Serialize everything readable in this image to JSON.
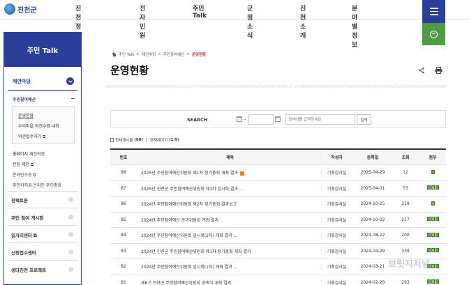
{
  "header": {
    "logo_text": "진천군",
    "nav": [
      "진천 정보공개",
      "전자민원",
      "주민 Talk",
      "군정소식",
      "진천소개",
      "분야별정보"
    ]
  },
  "sidebar": {
    "title": "주민 Talk",
    "category": "제안마당",
    "sub_items": [
      "주민참여예산",
      "운영현황",
      "우리마을 의견수렴 내용",
      "의견접수하기 ⧉"
    ],
    "other_items": [
      "홈페이지 개선의견",
      "전정 제안 ⧉",
      "온라인소송 ⧉",
      "주민자치회 온라인 주민총회"
    ],
    "main_items": [
      "정책토론",
      "주민 참여 게시판",
      "일자리센터 ⧉",
      "신청접수센터",
      "생다진천 프로젝트"
    ]
  },
  "breadcrumb": [
    "주민 Talk",
    "제안마당",
    "주민참여예산",
    "운영현황"
  ],
  "page": {
    "title": "운영현황"
  },
  "search": {
    "label": "SEARCH",
    "dash": "-",
    "keyword_placeholder": "검색어를 입력하세요",
    "submit_label": "검색"
  },
  "count": {
    "total_label": "전체게시물",
    "total": "(88)",
    "page_label": "현재페이지",
    "page": "(1/9)"
  },
  "board": {
    "headers": [
      "번호",
      "제목",
      "작성자",
      "등록일",
      "조회",
      "첨부"
    ],
    "rows": [
      {
        "no": "88",
        "title": "2025년 주민참여예산위원회 제1차 정기총회 개최 결과",
        "dept": "기획감사실",
        "date": "2025-04-29",
        "views": "12",
        "files": 1,
        "new": true
      },
      {
        "no": "87",
        "title": "2025년 진천군 주민참여예산위원회 제1차 임시회 결과...",
        "dept": "기획감사실",
        "date": "2025-04-01",
        "views": "53",
        "files": 3,
        "new": false
      },
      {
        "no": "86",
        "title": "2024년 주민참여예산위원회 제2차 정기총회 결과보고",
        "dept": "기획감사실",
        "date": "2024-10-25",
        "views": "219",
        "files": 1,
        "new": false
      },
      {
        "no": "85",
        "title": "2024년 주민참여예산 분과위원회 개최 결과",
        "dept": "기획감사실",
        "date": "2024-10-02",
        "views": "217",
        "files": 3,
        "new": false
      },
      {
        "no": "84",
        "title": "2024년 주민참여예산위원회 임시회(2차) 개최 결과 ...",
        "dept": "기획감사실",
        "date": "2024-08-22",
        "views": "200",
        "files": 3,
        "new": false
      },
      {
        "no": "83",
        "title": "2024년 진천군 주민참여예산위원회 제1차 정기총회 개최 결과",
        "dept": "기획감사실",
        "date": "2024-04-29",
        "views": "339",
        "files": 3,
        "new": false
      },
      {
        "no": "82",
        "title": "2024년 주민참여예산위원회 임시회(1차) 개최 결과 ...",
        "dept": "기획감사실",
        "date": "2024-03-21",
        "views": "",
        "files": 3,
        "new": false
      },
      {
        "no": "81",
        "title": "제6기 진천군 주민참여예산위원회 위촉식 개최 결과",
        "dept": "기획감사실",
        "date": "2024-02-28",
        "views": "293",
        "files": 3,
        "new": false
      }
    ]
  },
  "watermark": "브릿지저널",
  "colors": {
    "primary": "#2b3f9a",
    "search_green": "#4e9b43",
    "breadcrumb_active": "#c0392b"
  },
  "icons": [
    "logo-icon",
    "menu-icon",
    "search-icon",
    "home-icon",
    "share-icon",
    "print-icon",
    "calendar-icon",
    "toggle-icon",
    "file-icon",
    "new-icon"
  ]
}
